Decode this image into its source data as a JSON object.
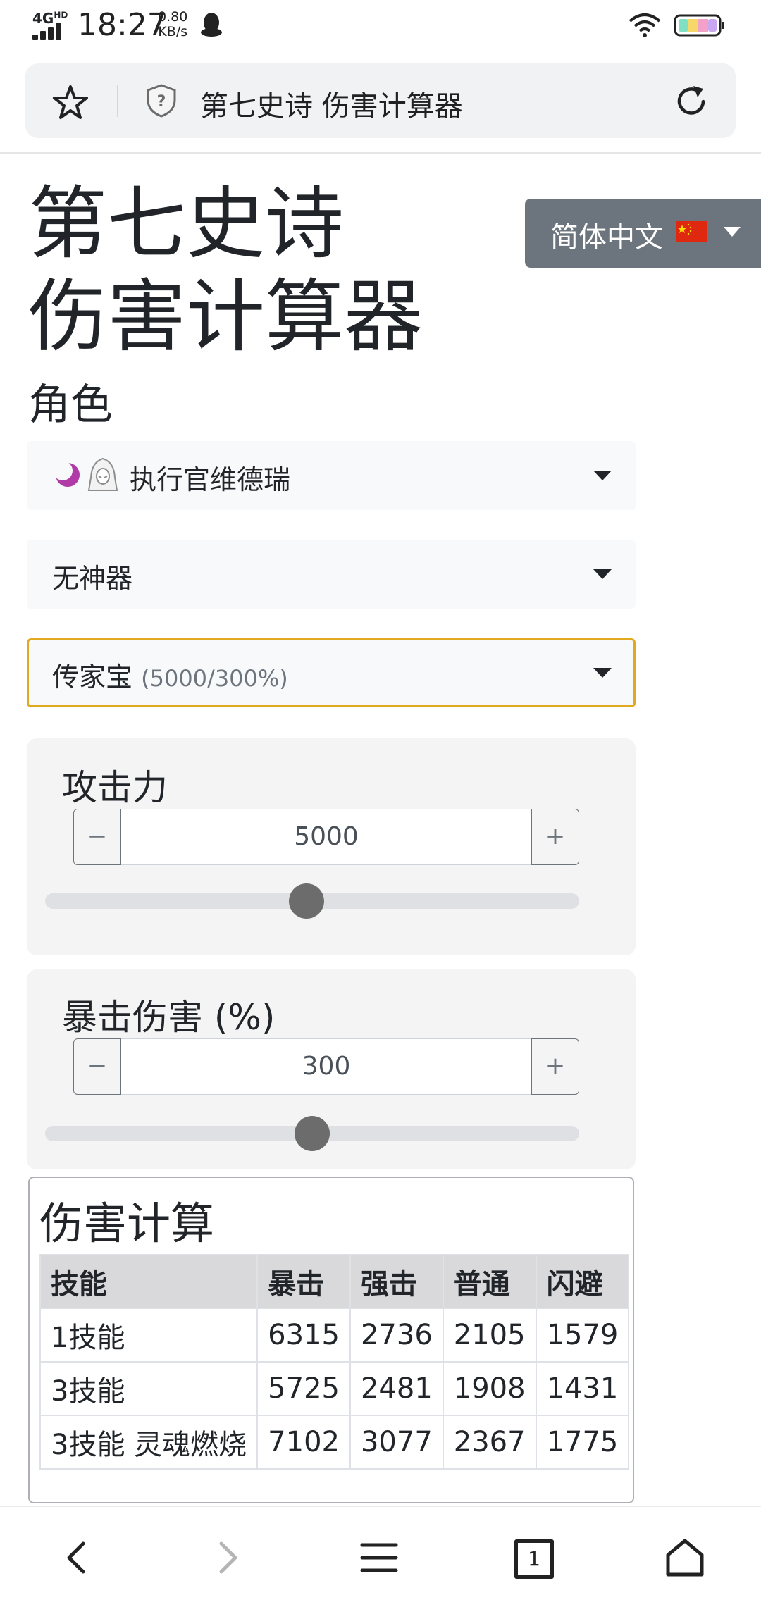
{
  "status_bar": {
    "network": "4G",
    "network_hd": "HD",
    "time": "18:27",
    "speed_value": "0.80",
    "speed_unit": "KB/s",
    "icons": [
      "signal-icon",
      "qq-icon",
      "wifi-icon",
      "battery-icon"
    ]
  },
  "browser": {
    "page_title": "第七史诗 伤害计算器",
    "icons": [
      "star-icon",
      "shield-question-icon",
      "reload-icon"
    ]
  },
  "header": {
    "title": "第七史诗 伤害计算器",
    "language_label": "简体中文",
    "language_flag": "china-flag-icon"
  },
  "character_section": {
    "label": "角色",
    "hero_select": "执行官维德瑞",
    "artifact_select": "无神器",
    "preset_select": "传家宝",
    "preset_detail": "(5000/300%)"
  },
  "attack": {
    "label": "攻击力",
    "value": "5000",
    "minus": "−",
    "plus": "+",
    "slider_fraction": 0.49
  },
  "crit_damage": {
    "label": "暴击伤害 (%)",
    "value": "300",
    "minus": "−",
    "plus": "+",
    "slider_fraction": 0.5
  },
  "damage": {
    "title": "伤害计算",
    "headers": [
      "技能",
      "暴击",
      "强击",
      "普通",
      "闪避"
    ],
    "rows": [
      [
        "1技能",
        "6315",
        "2736",
        "2105",
        "1579"
      ],
      [
        "3技能",
        "5725",
        "2481",
        "1908",
        "1431"
      ],
      [
        "3技能 灵魂燃烧",
        "7102",
        "3077",
        "2367",
        "1775"
      ]
    ]
  },
  "nav": {
    "tab_count": "1",
    "icons": [
      "back-icon",
      "forward-icon",
      "menu-icon",
      "tabs-icon",
      "home-icon"
    ]
  },
  "colors": {
    "lang_button": "#6c757d",
    "preset_border": "#e0a920",
    "card_bg": "#f4f4f5",
    "table_header": "#d9d9db",
    "slider_thumb": "#6c6c6c"
  }
}
